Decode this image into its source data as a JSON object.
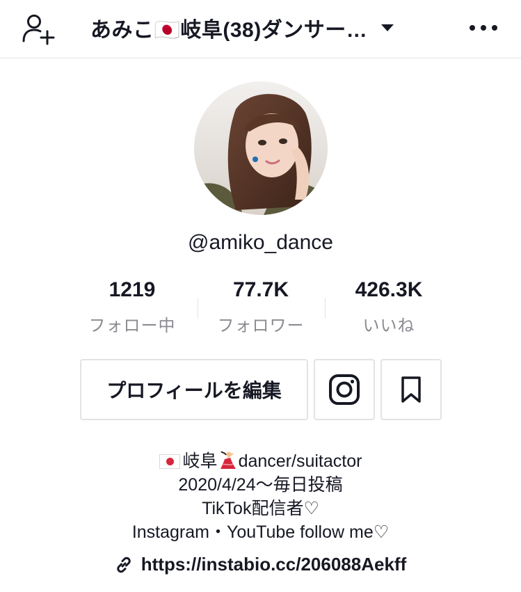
{
  "header": {
    "title": "あみこ🇯🇵岐阜(38)ダンサー…",
    "add_user_icon": "person-add-icon",
    "chevron_icon": "caret-down-icon",
    "more_icon": "more-horizontal-icon"
  },
  "profile": {
    "username": "@amiko_dance",
    "stats": [
      {
        "value": "1219",
        "label": "フォロー中"
      },
      {
        "value": "77.7K",
        "label": "フォロワー"
      },
      {
        "value": "426.3K",
        "label": "いいね"
      }
    ],
    "edit_button_label": "プロフィールを編集",
    "instagram_icon": "instagram-icon",
    "bookmark_icon": "bookmark-icon"
  },
  "bio": {
    "line1_a": "岐阜",
    "line1_b": "dancer/suitactor",
    "line2": "2020/4/24〜毎日投稿",
    "line3": "TikTok配信者♡",
    "line4": "Instagram・YouTube follow me♡"
  },
  "link": {
    "text": "https://instabio.cc/206088Aekff",
    "icon": "link-icon"
  },
  "colors": {
    "text": "#161823",
    "secondary": "#8a8b91",
    "border": "#e3e3e4"
  }
}
